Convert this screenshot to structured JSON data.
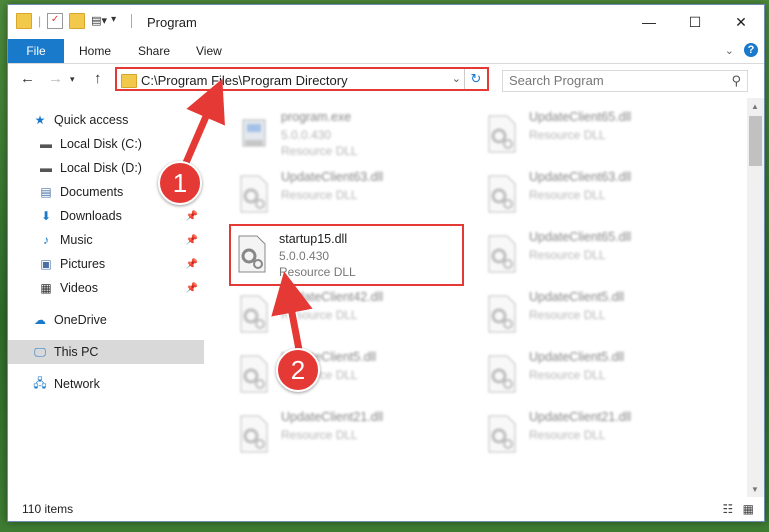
{
  "window": {
    "title": "Program",
    "qat_separator": "|"
  },
  "ribbon": {
    "tabs": [
      "File",
      "Home",
      "Share",
      "View"
    ],
    "help_label": "?"
  },
  "address": {
    "path": "C:\\Program Files\\Program Directory",
    "search_placeholder": "Search Program"
  },
  "nav": {
    "items": [
      {
        "label": "Quick access",
        "icon": "star-icon"
      },
      {
        "label": "Local Disk (C:)",
        "icon": "drive-icon"
      },
      {
        "label": "Local Disk (D:)",
        "icon": "drive-icon"
      },
      {
        "label": "Documents",
        "icon": "documents-icon"
      },
      {
        "label": "Downloads",
        "icon": "downloads-icon"
      },
      {
        "label": "Music",
        "icon": "music-icon"
      },
      {
        "label": "Pictures",
        "icon": "pictures-icon"
      },
      {
        "label": "Videos",
        "icon": "videos-icon"
      },
      {
        "label": "OneDrive",
        "icon": "cloud-icon"
      },
      {
        "label": "This PC",
        "icon": "computer-icon"
      },
      {
        "label": "Network",
        "icon": "network-icon"
      }
    ]
  },
  "files": {
    "left": [
      {
        "name": "program.exe",
        "l2": "5.0.0.430",
        "l3": "Resource DLL"
      },
      {
        "name": "UpdateClient63.dll",
        "l2": "Resource DLL",
        "l3": ""
      },
      {
        "name": "startup15.dll",
        "l2": "5.0.0.430",
        "l3": "Resource DLL"
      },
      {
        "name": "UpdateClient42.dll",
        "l2": "Resource DLL",
        "l3": ""
      },
      {
        "name": "UpdateClient5.dll",
        "l2": "Resource DLL",
        "l3": ""
      },
      {
        "name": "UpdateClient21.dll",
        "l2": "Resource DLL",
        "l3": ""
      }
    ],
    "right": [
      {
        "name": "UpdateClient65.dll",
        "l2": "Resource DLL"
      },
      {
        "name": "UpdateClient63.dll",
        "l2": "Resource DLL"
      },
      {
        "name": "UpdateClient65.dll",
        "l2": "Resource DLL"
      },
      {
        "name": "UpdateClient5.dll",
        "l2": "Resource DLL"
      },
      {
        "name": "UpdateClient5.dll",
        "l2": "Resource DLL"
      },
      {
        "name": "UpdateClient21.dll",
        "l2": "Resource DLL"
      }
    ]
  },
  "status": {
    "item_count": "110 items"
  },
  "annotations": {
    "badge1": "1",
    "badge2": "2"
  },
  "colors": {
    "accent": "#1979ca",
    "highlight": "#e53935"
  }
}
